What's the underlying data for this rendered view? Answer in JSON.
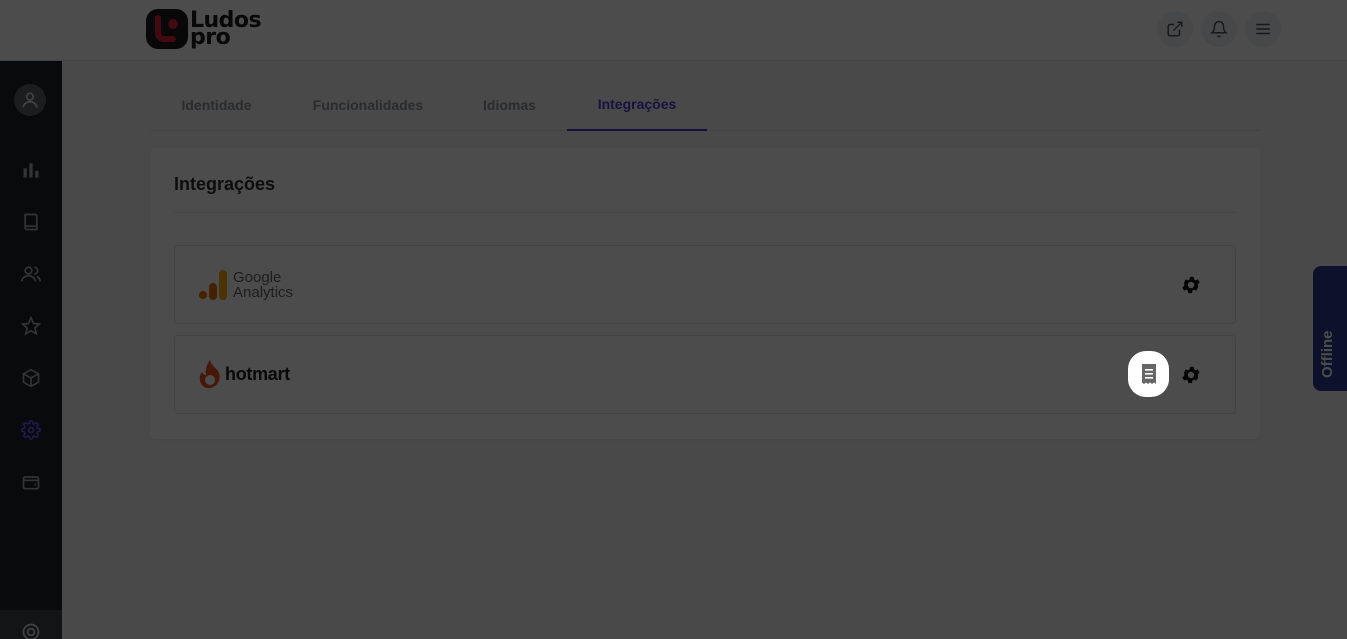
{
  "header": {
    "logo_line1": "Ludos",
    "logo_line2": "pro",
    "buttons": [
      "external-link",
      "bell",
      "menu"
    ]
  },
  "sidebar": {
    "items": [
      "dashboard",
      "book",
      "users",
      "star",
      "box",
      "settings",
      "wallet"
    ]
  },
  "tabs": [
    {
      "label": "Identidade",
      "active": false
    },
    {
      "label": "Funcionalidades",
      "active": false
    },
    {
      "label": "Idiomas",
      "active": false
    },
    {
      "label": "Integrações",
      "active": true
    }
  ],
  "card": {
    "title": "Integrações",
    "integrations": [
      {
        "name_line1": "Google",
        "name_line2": "Analytics",
        "logo": "google-analytics-logo"
      },
      {
        "name": "hotmart",
        "logo": "hotmart-logo"
      }
    ]
  },
  "offline_label": "Offline",
  "colors": {
    "accent": "#4b3bd6",
    "sidebar": "#1b2430",
    "offline": "#2f3a8f",
    "hotmart": "#f04e23",
    "ga_orange": "#f9ab00",
    "ga_dark": "#e37400"
  }
}
